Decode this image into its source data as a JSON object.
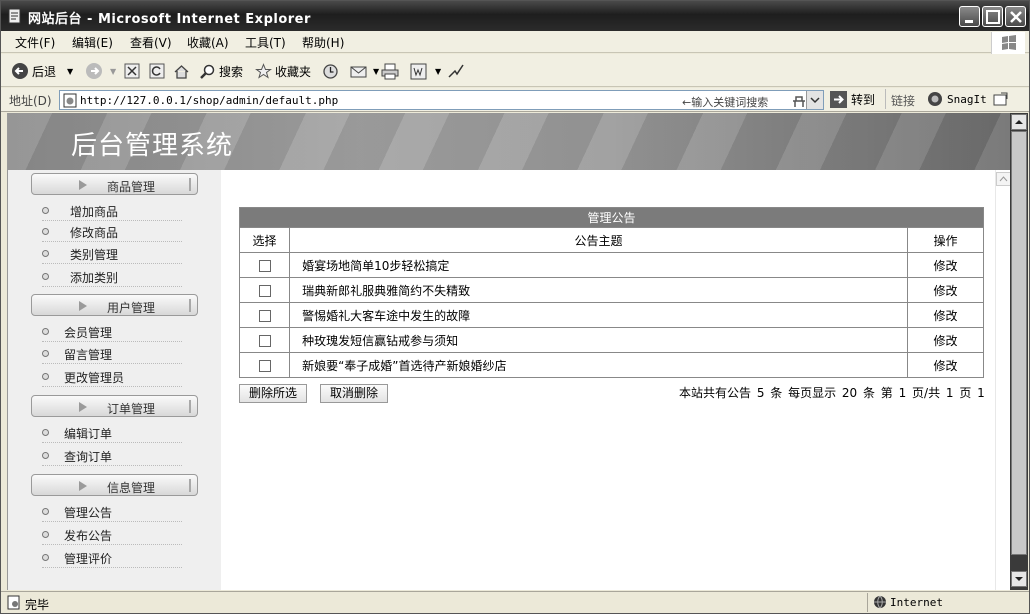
{
  "window": {
    "title": "网站后台 - Microsoft Internet Explorer"
  },
  "menu": [
    "文件(F)",
    "编辑(E)",
    "查看(V)",
    "收藏(A)",
    "工具(T)",
    "帮助(H)"
  ],
  "toolbar": {
    "back": "后退",
    "search": "搜索",
    "favorites": "收藏夹"
  },
  "address": {
    "label": "地址(D)",
    "url": "http://127.0.0.1/shop/admin/default.php",
    "search_hint": "←输入关键词搜索",
    "go": "转到",
    "links": "链接",
    "snagit": "SnagIt"
  },
  "banner": {
    "title": "后台管理系统"
  },
  "sidebar": {
    "sections": [
      {
        "title": "商品管理",
        "items": [
          "增加商品",
          "修改商品",
          "类别管理",
          "添加类别"
        ]
      },
      {
        "title": "用户管理",
        "items": [
          "会员管理",
          "留言管理",
          "更改管理员"
        ]
      },
      {
        "title": "订单管理",
        "items": [
          "编辑订单",
          "查询订单"
        ]
      },
      {
        "title": "信息管理",
        "items": [
          "管理公告",
          "发布公告",
          "管理评价"
        ]
      }
    ]
  },
  "table": {
    "caption": "管理公告",
    "headers": {
      "select": "选择",
      "subject": "公告主题",
      "action": "操作"
    },
    "rows": [
      {
        "subject": "婚宴场地简单10步轻松搞定",
        "action": "修改"
      },
      {
        "subject": "瑞典新郎礼服典雅简约不失精致",
        "action": "修改"
      },
      {
        "subject": "警惕婚礼大客车途中发生的故障",
        "action": "修改"
      },
      {
        "subject": "种玫瑰发短信赢钻戒参与须知",
        "action": "修改"
      },
      {
        "subject": "新娘要“奉子成婚”首选待产新娘婚纱店",
        "action": "修改"
      }
    ]
  },
  "actions": {
    "delete_selected": "删除所选",
    "cancel_delete": "取消删除"
  },
  "pager": {
    "text": "本站共有公告 5  条 每页显示 20 条 第 1 页/共 1 页 1"
  },
  "status": {
    "text": "完毕",
    "zone": "Internet"
  }
}
